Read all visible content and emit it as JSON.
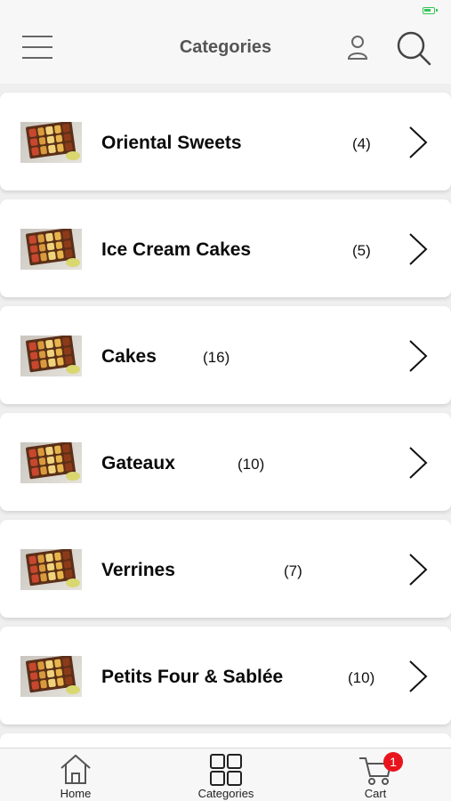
{
  "header": {
    "title": "Categories",
    "menu_icon": "hamburger-menu-icon",
    "user_icon": "user-icon",
    "search_icon": "search-icon"
  },
  "categories": [
    {
      "name": "Oriental Sweets",
      "count": "(4)"
    },
    {
      "name": "Ice Cream Cakes",
      "count": "(5)"
    },
    {
      "name": "Cakes",
      "count": "(16)"
    },
    {
      "name": "Gateaux",
      "count": "(10)"
    },
    {
      "name": "Verrines",
      "count": "(7)"
    },
    {
      "name": "Petits Four & Sablée",
      "count": "(10)"
    }
  ],
  "bottom_nav": {
    "home": "Home",
    "categories": "Categories",
    "cart": "Cart",
    "cart_badge": "1"
  },
  "colors": {
    "badge": "#e8141c",
    "battery": "#35c759"
  }
}
